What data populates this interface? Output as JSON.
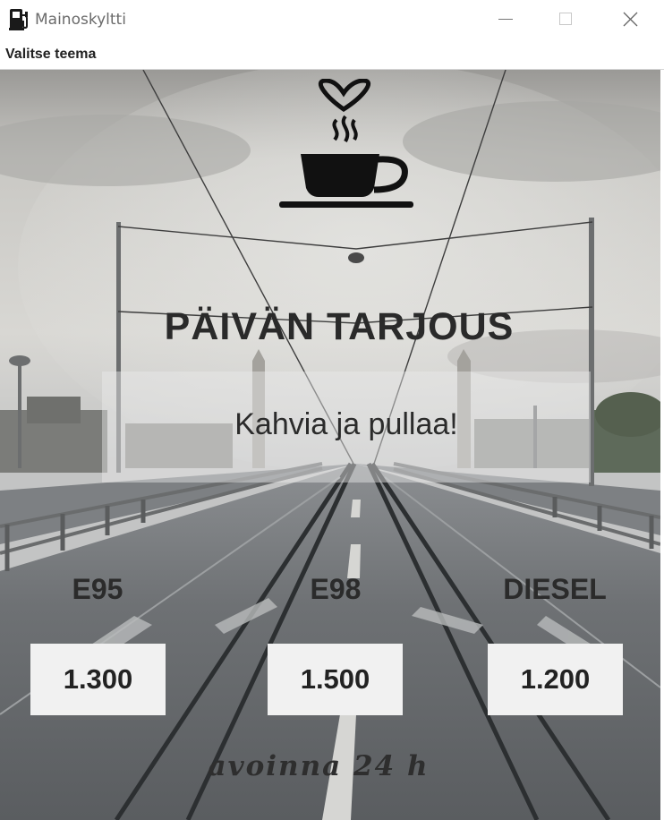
{
  "window": {
    "title": "Mainoskyltti",
    "icon": "fuel-pump-icon"
  },
  "menu": {
    "items": [
      "Valitse teema"
    ]
  },
  "sign": {
    "theme_icon": "coffee-cup-heart-icon",
    "offer_title": "PÄIVÄN TARJOUS",
    "offer_text": "Kahvia ja pullaa!",
    "fuels": [
      {
        "name": "E95",
        "price": "1.300"
      },
      {
        "name": "E98",
        "price": "1.500"
      },
      {
        "name": "DIESEL",
        "price": "1.200"
      }
    ],
    "hours": "avoinna 24 h"
  },
  "colors": {
    "sky": "#b9b9b6",
    "text_dark": "#2a2a2a",
    "price_box": "#f1f1f1"
  }
}
